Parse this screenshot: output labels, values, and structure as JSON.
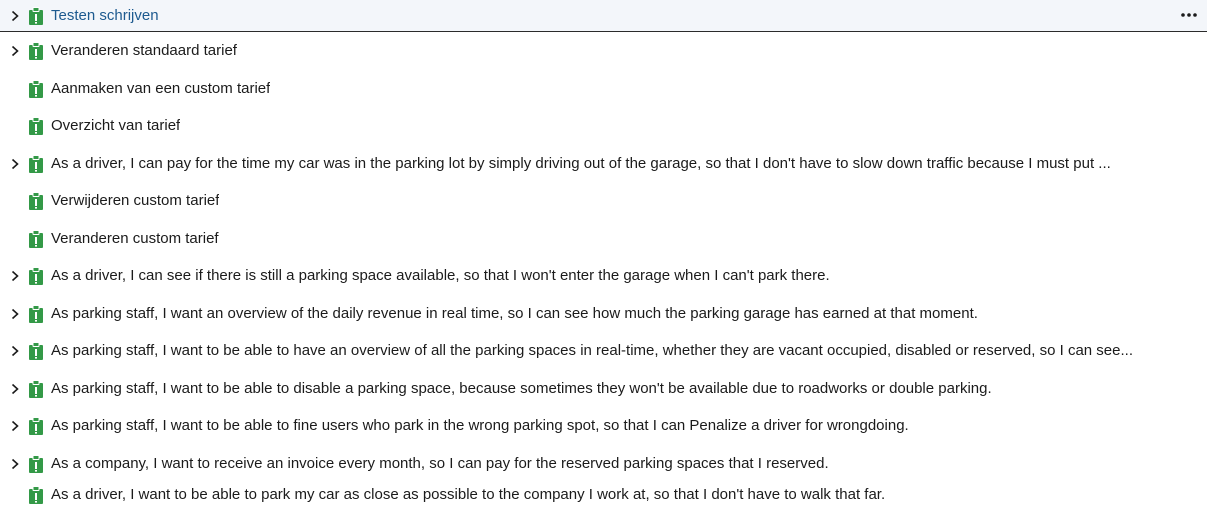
{
  "colors": {
    "pbi_green": "#339947",
    "selected_text": "#1d5a8f",
    "selected_bg": "#f3f6fa",
    "text": "#1b1b1b"
  },
  "icons": {
    "expand": "chevron-right-icon",
    "item": "product-backlog-item-icon",
    "more": "more-actions-icon"
  },
  "items": [
    {
      "title": "Testen schrijven",
      "expandable": true,
      "selected": true
    },
    {
      "title": "Veranderen standaard tarief",
      "expandable": true
    },
    {
      "title": "Aanmaken van een custom tarief",
      "expandable": false
    },
    {
      "title": "Overzicht van tarief",
      "expandable": false
    },
    {
      "title": "As a driver, I can pay for the time my car was in the parking lot by simply driving out of the garage, so that I don't have to slow down traffic because I must put ...",
      "expandable": true
    },
    {
      "title": "Verwijderen custom tarief",
      "expandable": false
    },
    {
      "title": "Veranderen custom tarief",
      "expandable": false
    },
    {
      "title": "As a driver, I can see if there is still a parking space available, so that I won't enter the garage when I can't park there.",
      "expandable": true
    },
    {
      "title": "As parking staff, I want an overview of the daily revenue in real time, so I can see how much the parking garage has earned at that moment.",
      "expandable": true
    },
    {
      "title": "As parking staff, I want to be able to have an overview of all the parking spaces in real-time, whether they are vacant occupied, disabled or reserved, so I can see...",
      "expandable": true
    },
    {
      "title": "As parking staff, I want to be able to disable a parking space, because sometimes they won't be available due to roadworks or double parking.",
      "expandable": true
    },
    {
      "title": "As parking staff, I want to be able to fine users who park in the wrong parking spot, so that I can Penalize a driver for wrongdoing.",
      "expandable": true
    },
    {
      "title": "As a company, I want to receive an invoice every month, so I can pay for the reserved parking spaces that I reserved.",
      "expandable": true
    },
    {
      "title": "As a driver, I want to be able to park my car as close as possible to the company I work at, so that I don't have to walk that far.",
      "expandable": false
    }
  ]
}
